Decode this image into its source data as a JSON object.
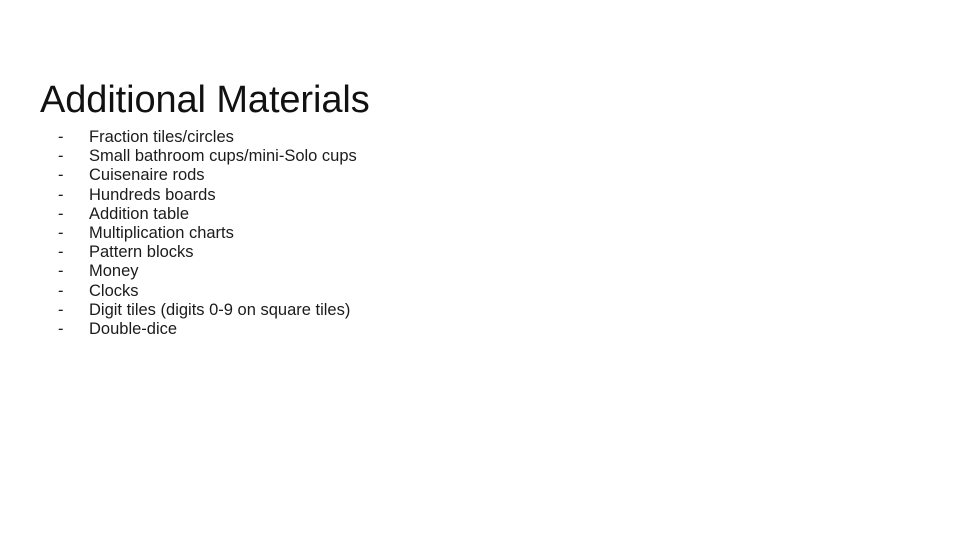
{
  "slide": {
    "title": "Additional Materials",
    "background_color": "#ffffff",
    "text_color": "#1b1b1b",
    "title_color": "#111111",
    "bullet_marker": "-",
    "items": [
      {
        "marker": "-",
        "text": "Fraction tiles/circles"
      },
      {
        "marker": "-",
        "text": "Small bathroom cups/mini-Solo cups"
      },
      {
        "marker": "-",
        "text": "Cuisenaire rods"
      },
      {
        "marker": "-",
        "text": "Hundreds boards"
      },
      {
        "marker": "-",
        "text": "Addition table"
      },
      {
        "marker": "-",
        "text": "Multiplication charts"
      },
      {
        "marker": "-",
        "text": "Pattern blocks"
      },
      {
        "marker": "-",
        "text": "Money"
      },
      {
        "marker": "-",
        "text": "Clocks"
      },
      {
        "marker": "-",
        "text": "Digit tiles (digits 0-9 on square tiles)"
      },
      {
        "marker": "-",
        "text": "Double-dice"
      }
    ]
  }
}
